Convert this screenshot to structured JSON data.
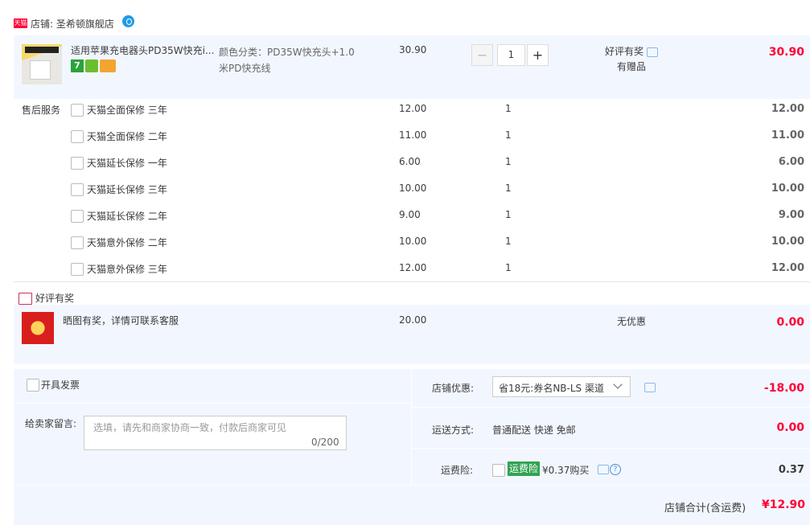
{
  "shop": {
    "badge": "天猫",
    "label": "店铺: 圣希顿旗舰店"
  },
  "item": {
    "title": "适用苹果充电器头PD35W快充i...",
    "badge_seven": "7",
    "sku": "颜色分类：PD35W快充头+1.0米PD快充线",
    "price": "30.90",
    "qty": "1",
    "minus": "−",
    "plus": "+",
    "promo_line1": "好评有奖",
    "promo_line2": "有赠品",
    "total": "30.90"
  },
  "service": {
    "label": "售后服务",
    "rows": [
      {
        "name": "天猫全面保修 三年",
        "price": "12.00",
        "qty": "1",
        "total": "12.00"
      },
      {
        "name": "天猫全面保修 二年",
        "price": "11.00",
        "qty": "1",
        "total": "11.00"
      },
      {
        "name": "天猫延长保修 一年",
        "price": "6.00",
        "qty": "1",
        "total": "6.00"
      },
      {
        "name": "天猫延长保修 三年",
        "price": "10.00",
        "qty": "1",
        "total": "10.00"
      },
      {
        "name": "天猫延长保修 二年",
        "price": "9.00",
        "qty": "1",
        "total": "9.00"
      },
      {
        "name": "天猫意外保修 二年",
        "price": "10.00",
        "qty": "1",
        "total": "10.00"
      },
      {
        "name": "天猫意外保修 三年",
        "price": "12.00",
        "qty": "1",
        "total": "12.00"
      }
    ]
  },
  "gift": {
    "header": "好评有奖",
    "title": "晒图有奖，详情可联系客服",
    "price": "20.00",
    "discount": "无优惠",
    "total": "0.00"
  },
  "footer": {
    "invoice_label": "开具发票",
    "message_label": "给卖家留言:",
    "message_placeholder": "选填，请先和商家协商一致，付款后商家可见",
    "message_count": "0/200",
    "coupon_label": "店铺优惠:",
    "coupon_value": "省18元:券名NB-LS 渠道",
    "coupon_amount": "-18.00",
    "shipping_label": "运送方式:",
    "shipping_value": "普通配送 快递 免邮",
    "shipping_amount": "0.00",
    "insurance_label": "运费险:",
    "insurance_badge": "运费险",
    "insurance_price": "¥0.37购买",
    "insurance_amount": "0.37",
    "help": "?",
    "sum_label": "店铺合计(含运费)",
    "sum_value": "¥12.90"
  },
  "colors": {
    "accent_red": "#ff0036",
    "panel_bg": "#f2f7ff",
    "insurance_green": "#31a353",
    "chat_blue": "#8bb8e8"
  }
}
